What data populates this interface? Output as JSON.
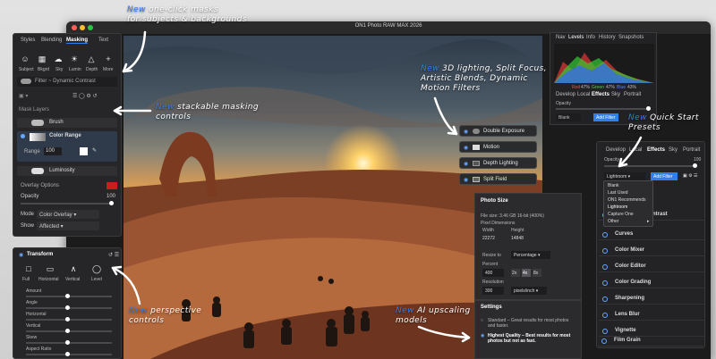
{
  "app": {
    "title": "ON1 Photo RAW MAX 2026"
  },
  "annotations": {
    "masks": {
      "hl": "New",
      "line1": "one-click masks",
      "line2": "for subjects & backgrounds"
    },
    "stack": {
      "hl": "New",
      "line1": "stackable masking",
      "line2": "controls"
    },
    "lighting": {
      "hl": "New",
      "line1": "3D lighting, Split Focus,",
      "line2": "Artistic Blends, Dynamic",
      "line3": "Motion Filters"
    },
    "presets": {
      "hl": "New",
      "line1": "Quick Start",
      "line2": "Presets"
    },
    "persp": {
      "hl": "New",
      "line1": "perspective",
      "line2": "controls"
    },
    "upscale": {
      "hl": "New",
      "line1": "AI upscaling",
      "line2": "models"
    }
  },
  "left_panel": {
    "tabs": [
      "Styles",
      "Blending",
      "Masking",
      "Text"
    ],
    "active_tab": "Masking",
    "subjects": [
      "Subject",
      "Bkgrd",
      "Sky",
      "Lumin",
      "Depth",
      "More"
    ],
    "filter_name": "Filter ~ Dynamic Contrast",
    "mask_layers_label": "Mask Layers",
    "layers": [
      "Brush",
      "Color Range",
      "Luminosity"
    ],
    "range_label": "Range",
    "range_value": "100",
    "overlay_options": "Overlay Options",
    "opacity_label": "Opacity",
    "opacity_value": "100",
    "mode_label": "Mode",
    "mode_value": "Color Overlay",
    "show_label": "Show",
    "show_value": "Affected",
    "overlay_color": "#c81e1e"
  },
  "transform": {
    "title": "Transform",
    "buttons": [
      "Full",
      "Horizontal",
      "Vertical",
      "Level"
    ],
    "sliders": [
      "Amount",
      "Angle",
      "Horizontal",
      "Vertical",
      "Skew",
      "Aspect Ratio"
    ]
  },
  "filters": [
    "Double Exposure",
    "Motion",
    "Depth Lighting",
    "Split Field"
  ],
  "photo_size": {
    "title": "Photo Size",
    "file_size": "File size: 3.46 GB 16-bit (400%)",
    "pixel_dim": "Pixel Dimensions",
    "width_label": "Width",
    "height_label": "Height",
    "width": "22272",
    "height": "14848",
    "resize_label": "Resize to",
    "resize_value": "Percentage",
    "percent_label": "Percent",
    "percent_value": "400",
    "scales": [
      "2x",
      "4x",
      "8x"
    ],
    "resolution_label": "Resolution",
    "resolution_value": "300",
    "resolution_unit": "pixels/inch",
    "settings_title": "Settings",
    "standard_text": "Standard – Great results for most photos and faster.",
    "hq_text": "Highest Quality – Best results for most photos but not as fast."
  },
  "right_panel": {
    "tabs": [
      "Nav",
      "Levels",
      "Info",
      "History",
      "Snapshots"
    ],
    "active_tab": "Levels",
    "histogram_labels": [
      "Red",
      "47%",
      "Green",
      "47%",
      "Blue",
      "43%"
    ],
    "edit_tabs": [
      "Develop",
      "Local",
      "Effects",
      "Sky",
      "Portrait"
    ],
    "opacity_label": "Opacity",
    "blend_value": "Blank",
    "add_filter": "Add Filter"
  },
  "effects_panel": {
    "tabs": [
      "Develop",
      "Local",
      "Effects",
      "Sky",
      "Portrait"
    ],
    "opacity_label": "Opacity",
    "opacity_value": "100",
    "preset_value": "Lightroom",
    "add_filter": "Add Filter",
    "dropdown": [
      "Blank",
      "Last Used",
      "ON1 Recommends",
      "Lightroom",
      "Capture One",
      "Other"
    ],
    "items": [
      "Curves",
      "Color Mixer",
      "Color Editor",
      "Color Grading",
      "Sharpening",
      "Lens Blur",
      "Vignette",
      "Film Grain"
    ],
    "partial_item": "ntrast",
    "accent": "#2f7ff0"
  }
}
